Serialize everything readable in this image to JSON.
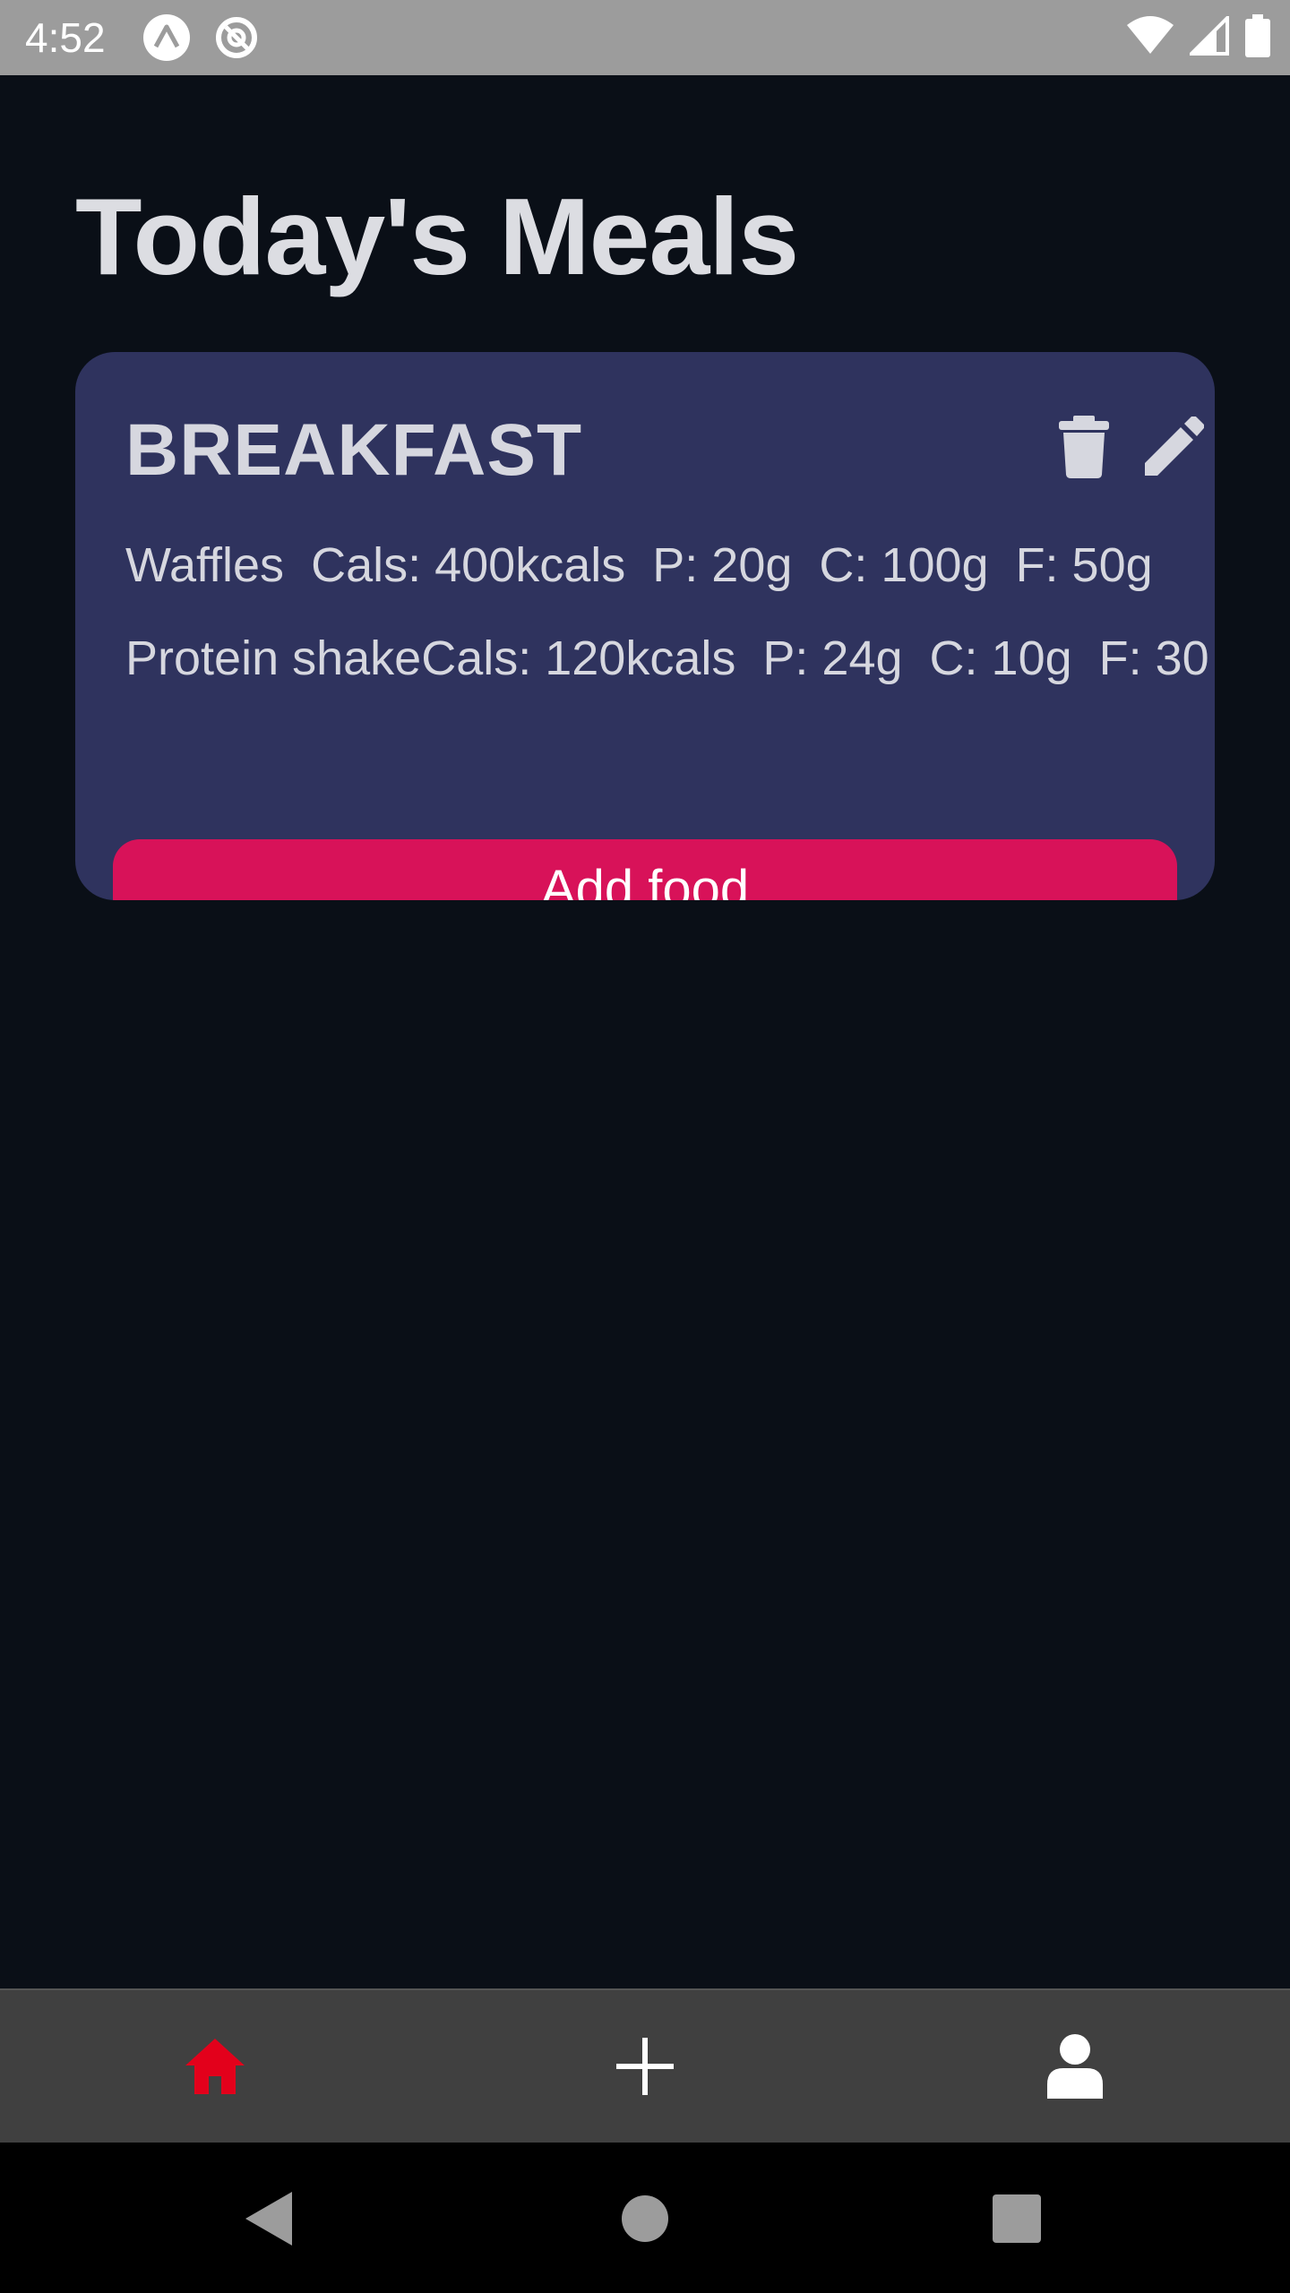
{
  "status_bar": {
    "time": "4:52",
    "icons": [
      "expo-icon",
      "data-saver-icon",
      "wifi-icon",
      "cell-signal-icon",
      "battery-icon"
    ]
  },
  "page": {
    "title": "Today's Meals"
  },
  "meal_card": {
    "title": "BREAKFAST",
    "actions": [
      "trash-icon",
      "pencil-icon"
    ],
    "foods": [
      {
        "name": "Waffles",
        "cals": "Cals: 400kcals",
        "protein": "P: 20g",
        "carbs": "C: 100g",
        "fat": "F: 50g"
      },
      {
        "name": "Protein shake",
        "cals": "Cals: 120kcals",
        "protein": "P: 24g",
        "carbs": "C: 10g",
        "fat": "F: 30"
      }
    ],
    "add_button_label": "Add food"
  },
  "tab_bar": {
    "tabs": [
      "home-icon",
      "plus-icon",
      "user-icon"
    ],
    "active_tab": "home-icon",
    "active_color": "#e3001b",
    "inactive_color": "#ffffff"
  },
  "nav_bar": {
    "buttons": [
      "back-icon",
      "home-circle-icon",
      "recents-icon"
    ]
  },
  "colors": {
    "background": "#0a0f17",
    "card": "#2f335e",
    "accent": "#d81259"
  }
}
